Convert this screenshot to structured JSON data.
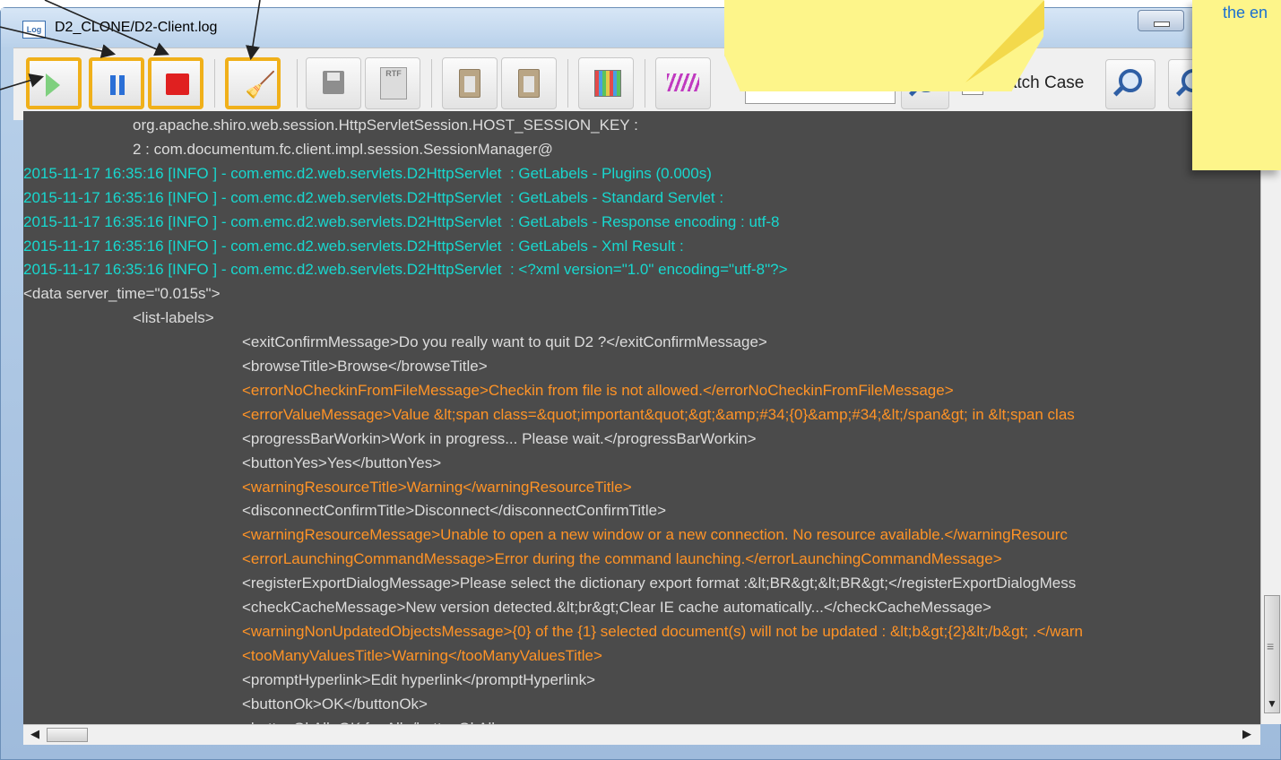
{
  "window": {
    "title": "D2_CLONE/D2-Client.log",
    "app_icon_text": "Log"
  },
  "toolbar": {
    "buttons": [
      "play",
      "pause",
      "stop",
      "clear",
      "save",
      "export-rtf",
      "copy",
      "paste",
      "select-colors",
      "highlight"
    ],
    "rtf_label": "RTF",
    "match_case_label": "Match Case",
    "search_value": ""
  },
  "annotations": {
    "note_text": "the en"
  },
  "log_lines": [
    {
      "text": "org.apache.shiro.web.session.HttpServletSession.HOST_SESSION_KEY :",
      "color": "white",
      "indent": 1
    },
    {
      "text": "2 : com.documentum.fc.client.impl.session.SessionManager@",
      "color": "white",
      "indent": 1
    },
    {
      "text": "2015-11-17 16:35:16 [INFO ] - com.emc.d2.web.servlets.D2HttpServlet  : GetLabels - Plugins (0.000s)",
      "color": "cyan",
      "indent": 0
    },
    {
      "text": "2015-11-17 16:35:16 [INFO ] - com.emc.d2.web.servlets.D2HttpServlet  : GetLabels - Standard Servlet :",
      "color": "cyan",
      "indent": 0
    },
    {
      "text": "2015-11-17 16:35:16 [INFO ] - com.emc.d2.web.servlets.D2HttpServlet  : GetLabels - Response encoding : utf-8",
      "color": "cyan",
      "indent": 0
    },
    {
      "text": "2015-11-17 16:35:16 [INFO ] - com.emc.d2.web.servlets.D2HttpServlet  : GetLabels - Xml Result :",
      "color": "cyan",
      "indent": 0
    },
    {
      "text": "2015-11-17 16:35:16 [INFO ] - com.emc.d2.web.servlets.D2HttpServlet  : <?xml version=\"1.0\" encoding=\"utf-8\"?>",
      "color": "cyan",
      "indent": 0
    },
    {
      "text": "<data server_time=\"0.015s\">",
      "color": "white",
      "indent": 0
    },
    {
      "text": "<list-labels>",
      "color": "white",
      "indent": 1
    },
    {
      "text": "<exitConfirmMessage>Do you really want to quit D2 ?</exitConfirmMessage>",
      "color": "white",
      "indent": 2
    },
    {
      "text": "<browseTitle>Browse</browseTitle>",
      "color": "white",
      "indent": 2
    },
    {
      "text": "<errorNoCheckinFromFileMessage>Checkin from file is not allowed.</errorNoCheckinFromFileMessage>",
      "color": "orange",
      "indent": 2
    },
    {
      "text": "<errorValueMessage>Value &lt;span class=&quot;important&quot;&gt;&amp;#34;{0}&amp;#34;&lt;/span&gt; in &lt;span clas",
      "color": "orange",
      "indent": 2
    },
    {
      "text": "<progressBarWorkin>Work in progress... Please wait.</progressBarWorkin>",
      "color": "white",
      "indent": 2
    },
    {
      "text": "<buttonYes>Yes</buttonYes>",
      "color": "white",
      "indent": 2
    },
    {
      "text": "<warningResourceTitle>Warning</warningResourceTitle>",
      "color": "orange",
      "indent": 2
    },
    {
      "text": "<disconnectConfirmTitle>Disconnect</disconnectConfirmTitle>",
      "color": "white",
      "indent": 2
    },
    {
      "text": "<warningResourceMessage>Unable to open a new window or a new connection. No resource available.</warningResourc",
      "color": "orange",
      "indent": 2
    },
    {
      "text": "<errorLaunchingCommandMessage>Error during the command launching.</errorLaunchingCommandMessage>",
      "color": "orange",
      "indent": 2
    },
    {
      "text": "<registerExportDialogMessage>Please select the dictionary export format :&lt;BR&gt;&lt;BR&gt;</registerExportDialogMess",
      "color": "white",
      "indent": 2
    },
    {
      "text": "<checkCacheMessage>New version detected.&lt;br&gt;Clear IE cache automatically...</checkCacheMessage>",
      "color": "white",
      "indent": 2
    },
    {
      "text": "<warningNonUpdatedObjectsMessage>{0} of the {1} selected document(s) will not be updated : &lt;b&gt;{2}&lt;/b&gt; .</warn",
      "color": "orange",
      "indent": 2
    },
    {
      "text": "<tooManyValuesTitle>Warning</tooManyValuesTitle>",
      "color": "orange",
      "indent": 2
    },
    {
      "text": "<promptHyperlink>Edit hyperlink</promptHyperlink>",
      "color": "white",
      "indent": 2
    },
    {
      "text": "<buttonOk>OK</buttonOk>",
      "color": "white",
      "indent": 2
    },
    {
      "text": "<buttonOkAll>OK for All</buttonOkAll>",
      "color": "white",
      "indent": 2
    }
  ]
}
